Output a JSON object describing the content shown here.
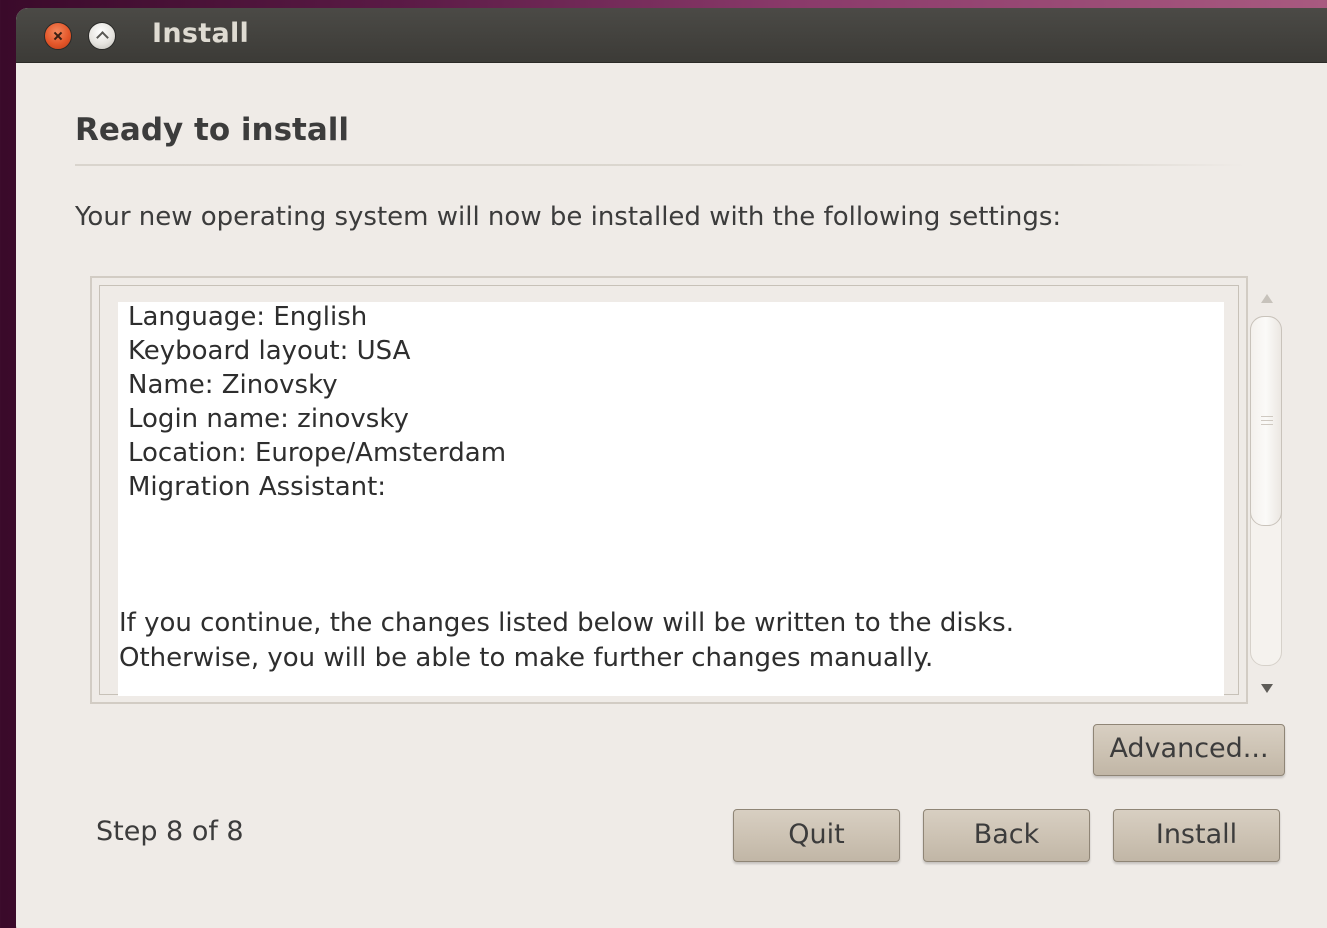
{
  "window": {
    "title": "Install"
  },
  "page": {
    "heading": "Ready to install",
    "intro": "Your new operating system will now be installed with the following settings:"
  },
  "settings": [
    "Language: English",
    "Keyboard layout: USA",
    "Name: Zinovsky",
    "Login name: zinovsky",
    "Location: Europe/Amsterdam",
    "Migration Assistant:"
  ],
  "note": [
    "If you continue, the changes listed below will be written to the disks.",
    "Otherwise, you will be able to make further changes manually."
  ],
  "buttons": {
    "advanced": "Advanced...",
    "quit": "Quit",
    "back": "Back",
    "install": "Install"
  },
  "footer": {
    "step": "Step 8 of 8"
  },
  "colors": {
    "window_bg": "#efebe7",
    "titlebar": "#3c3b37",
    "close_button": "#e4572a",
    "button_face": "#cdc3b4"
  }
}
